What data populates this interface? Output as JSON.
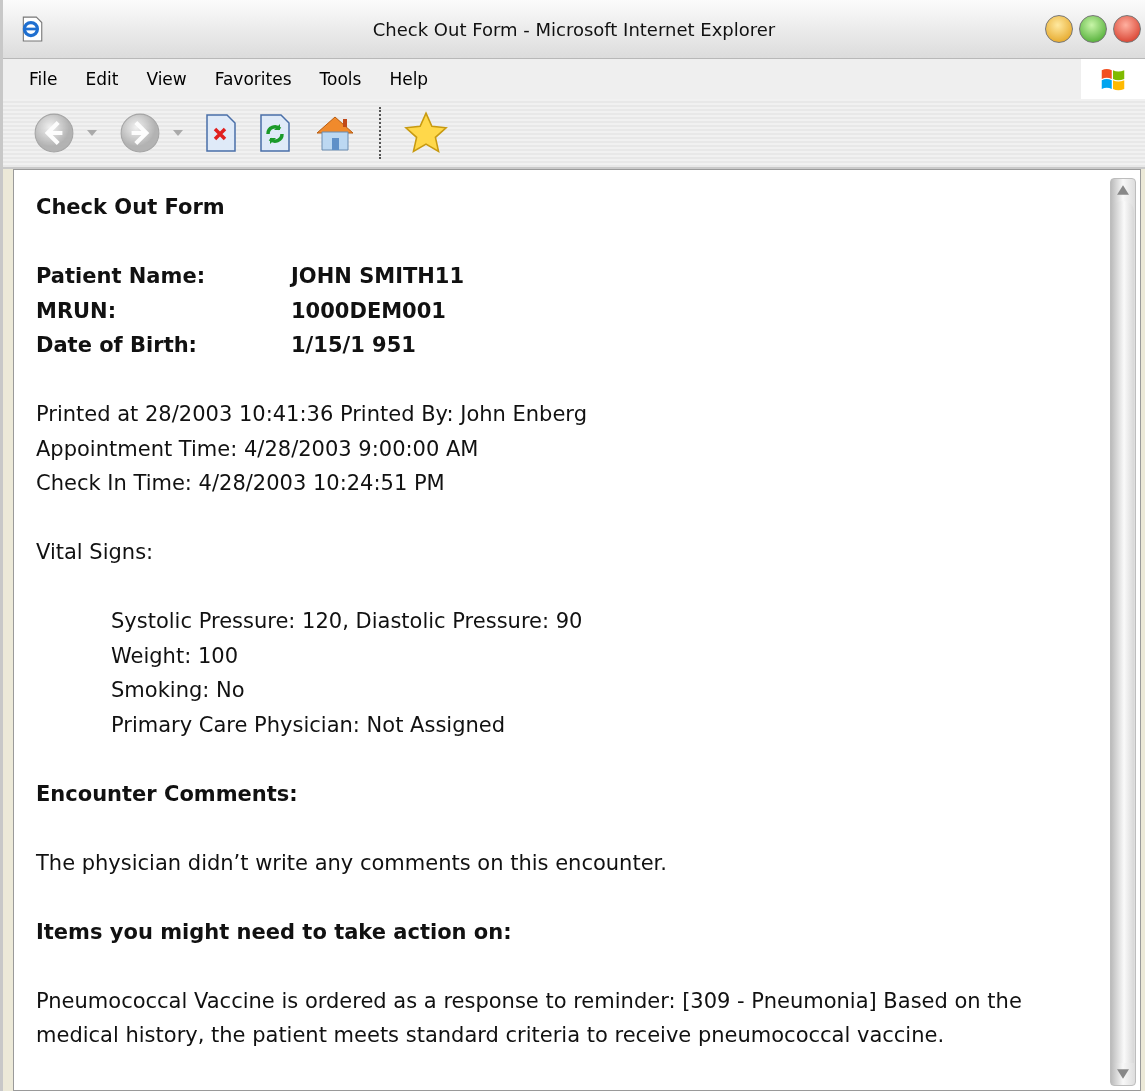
{
  "window": {
    "title": "Check Out Form - Microsoft Internet Explorer"
  },
  "menu": [
    "File",
    "Edit",
    "View",
    "Favorites",
    "Tools",
    "Help"
  ],
  "toolbar": [
    {
      "kind": "back",
      "disabled": true,
      "dropdown": true
    },
    {
      "kind": "forward",
      "disabled": true,
      "dropdown": true
    },
    {
      "kind": "stop",
      "disabled": false,
      "dropdown": false
    },
    {
      "kind": "refresh",
      "disabled": false,
      "dropdown": false
    },
    {
      "kind": "home",
      "disabled": false,
      "dropdown": false
    },
    {
      "kind": "separator",
      "disabled": false,
      "dropdown": false
    },
    {
      "kind": "favorites",
      "disabled": false,
      "dropdown": false
    }
  ],
  "page": {
    "heading": "Check Out Form",
    "patient_fields": [
      {
        "label": "Patient Name:",
        "value": "JOHN SMITH11"
      },
      {
        "label": "MRUN:",
        "value": "1000DEM001"
      },
      {
        "label": "Date of Birth:",
        "value": "1/15/1 951"
      }
    ],
    "print_info": [
      "Printed at 28/2003 10:41:36 Printed By: John Enberg",
      "Appointment Time: 4/28/2003 9:00:00 AM",
      "Check In Time: 4/28/2003 10:24:51 PM"
    ],
    "vital_signs": {
      "heading": "Vital Signs:",
      "items": [
        "Systolic Pressure: 120, Diastolic Pressure: 90",
        "Weight: 100",
        "Smoking: No",
        "Primary Care Physician: Not Assigned"
      ]
    },
    "encounter_comments": {
      "heading": "Encounter Comments:",
      "text": "The physician didn’t write any comments on this encounter."
    },
    "action_items": {
      "heading": "Items you might need to take action on:",
      "text": "Pneumococcal Vaccine is ordered as a response to reminder: [309 - Pneumonia] Based on the medical history, the patient meets standard criteria to receive pneumococcal vaccine."
    }
  }
}
